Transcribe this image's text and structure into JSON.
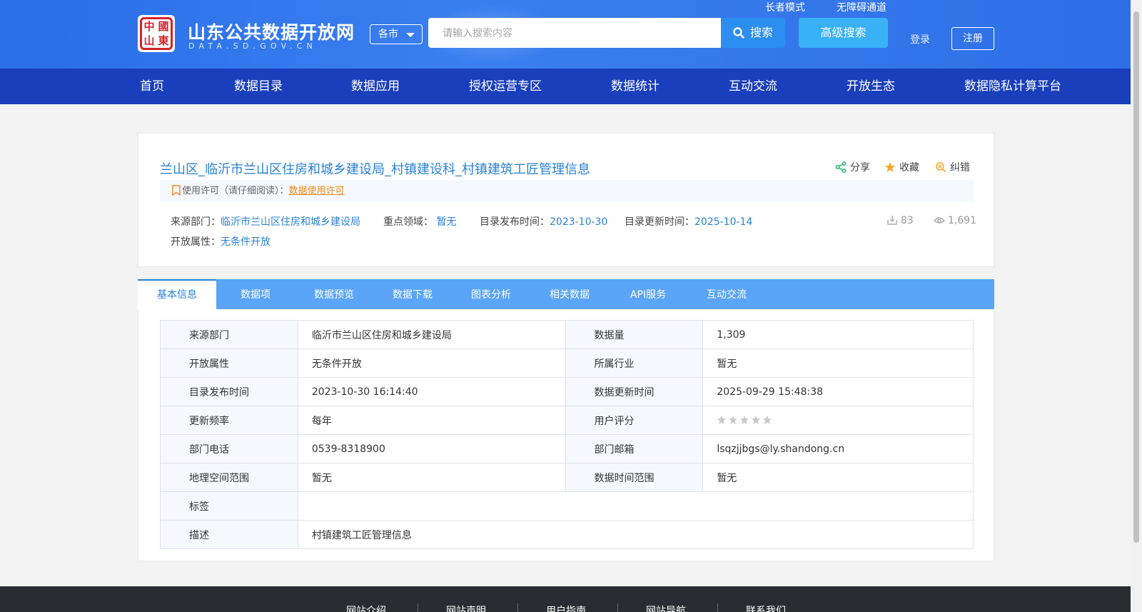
{
  "header": {
    "logo_seal_chars": [
      "中",
      "國",
      "山",
      "東"
    ],
    "site_name": "山东公共数据开放网",
    "site_domain": "DATA.SD.GOV.CN",
    "city_select": "各市",
    "search_placeholder": "请输入搜索内容",
    "search_label": "搜索",
    "advanced_search_label": "高级搜索",
    "elder_mode": "长者模式",
    "accessibility": "无障碍通道",
    "login": "登录",
    "register": "注册"
  },
  "nav": {
    "items": [
      "首页",
      "数据目录",
      "数据应用",
      "授权运营专区",
      "数据统计",
      "互动交流",
      "开放生态",
      "数据隐私计算平台"
    ]
  },
  "dataset": {
    "title": "兰山区_临沂市兰山区住房和城乡建设局_村镇建设科_村镇建筑工匠管理信息",
    "share": "分享",
    "favorite": "收藏",
    "correct": "纠错",
    "license_label": "使用许可（请仔细阅读）：",
    "license_link": "数据使用许可",
    "source_label": "来源部门：",
    "source_value": "临沂市兰山区住房和城乡建设局",
    "field_label": "重点领域：",
    "field_value": "暂无",
    "publish_label": "目录发布时间：",
    "publish_value": "2023-10-30",
    "update_label": "目录更新时间：",
    "update_value": "2025-10-14",
    "open_label": "开放属性：",
    "open_value": "无条件开放",
    "downloads": "83",
    "views": "1,691"
  },
  "tabs": [
    "基本信息",
    "数据项",
    "数据预览",
    "数据下载",
    "图表分析",
    "相关数据",
    "API服务",
    "互动交流"
  ],
  "info_table": {
    "rows": [
      {
        "k1": "来源部门",
        "v1": "临沂市兰山区住房和城乡建设局",
        "k2": "数据量",
        "v2": "1,309"
      },
      {
        "k1": "开放属性",
        "v1": "无条件开放",
        "k2": "所属行业",
        "v2": "暂无"
      },
      {
        "k1": "目录发布时间",
        "v1": "2023-10-30 16:14:40",
        "k2": "数据更新时间",
        "v2": "2025-09-29 15:48:38"
      },
      {
        "k1": "更新频率",
        "v1": "每年",
        "k2": "用户评分",
        "v2": ""
      },
      {
        "k1": "部门电话",
        "v1": "0539-8318900",
        "k2": "部门邮箱",
        "v2": "lsqzjjbgs@ly.shandong.cn"
      },
      {
        "k1": "地理空间范围",
        "v1": "暂无",
        "k2": "数据时间范围",
        "v2": "暂无"
      }
    ],
    "tag_label": "标签",
    "tag_value": "",
    "desc_label": "描述",
    "desc_value": "村镇建筑工匠管理信息",
    "rating_stars_filled": 0,
    "rating_stars_total": 5
  },
  "footer": {
    "links": [
      "网站介绍",
      "网站声明",
      "用户指南",
      "网站导航",
      "联系我们"
    ]
  },
  "colors": {
    "header_blue": "#2f6fe6",
    "nav_blue": "#1a3fbd",
    "link_blue": "#2a82d6",
    "tab_bar": "#5aa5f7",
    "license_orange": "#f08a1c"
  }
}
